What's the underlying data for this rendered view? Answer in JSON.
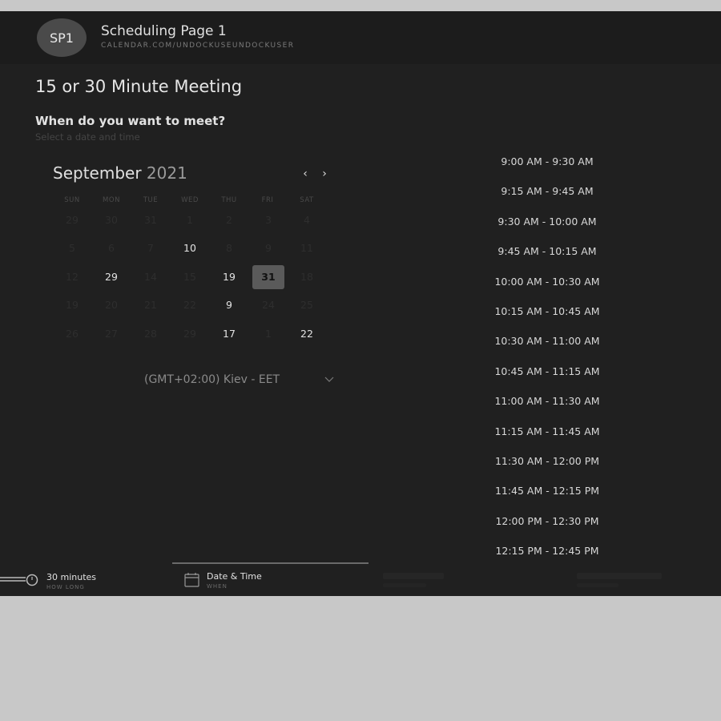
{
  "header": {
    "avatar_initials": "SP1",
    "title": "Scheduling Page 1",
    "url": "CALENDAR.COM/UNDOCKUSEUNDOCKUSER"
  },
  "meeting": {
    "title": "15 or 30 Minute Meeting",
    "question": "When do you want to meet?",
    "hint": "Select a date and time"
  },
  "calendar": {
    "month": "September",
    "year": "2021",
    "prev_label": "‹",
    "next_label": "›",
    "weekdays": [
      "SUN",
      "MON",
      "TUE",
      "WED",
      "THU",
      "FRI",
      "SAT"
    ],
    "weeks": [
      [
        {
          "d": "29",
          "a": false
        },
        {
          "d": "30",
          "a": false
        },
        {
          "d": "31",
          "a": false
        },
        {
          "d": "1",
          "a": false
        },
        {
          "d": "2",
          "a": false
        },
        {
          "d": "3",
          "a": false
        },
        {
          "d": "4",
          "a": false
        }
      ],
      [
        {
          "d": "5",
          "a": false
        },
        {
          "d": "6",
          "a": false
        },
        {
          "d": "7",
          "a": false
        },
        {
          "d": "10",
          "a": true
        },
        {
          "d": "8",
          "a": false
        },
        {
          "d": "9",
          "a": false
        },
        {
          "d": "11",
          "a": false
        }
      ],
      [
        {
          "d": "12",
          "a": false
        },
        {
          "d": "29",
          "a": true
        },
        {
          "d": "14",
          "a": false
        },
        {
          "d": "15",
          "a": false
        },
        {
          "d": "19",
          "a": true
        },
        {
          "d": "31",
          "a": true,
          "sel": true
        },
        {
          "d": "18",
          "a": false
        }
      ],
      [
        {
          "d": "19",
          "a": false
        },
        {
          "d": "20",
          "a": false
        },
        {
          "d": "21",
          "a": false
        },
        {
          "d": "22",
          "a": false
        },
        {
          "d": "9",
          "a": true
        },
        {
          "d": "24",
          "a": false
        },
        {
          "d": "25",
          "a": false
        }
      ],
      [
        {
          "d": "26",
          "a": false
        },
        {
          "d": "27",
          "a": false
        },
        {
          "d": "28",
          "a": false
        },
        {
          "d": "29",
          "a": false
        },
        {
          "d": "17",
          "a": true
        },
        {
          "d": "1",
          "a": false
        },
        {
          "d": "22",
          "a": true
        }
      ]
    ],
    "timezone": "(GMT+02:00) Kiev - EET"
  },
  "slots": [
    "9:00 AM - 9:30 AM",
    "9:15 AM - 9:45 AM",
    "9:30 AM - 10:00 AM",
    "9:45 AM - 10:15 AM",
    "10:00 AM - 10:30 AM",
    "10:15 AM - 10:45 AM",
    "10:30 AM - 11:00 AM",
    "10:45 AM - 11:15 AM",
    "11:00 AM - 11:30 AM",
    "11:15 AM - 11:45 AM",
    "11:30 AM - 12:00 PM",
    "11:45 AM - 12:15 PM",
    "12:00 PM - 12:30 PM",
    "12:15 PM - 12:45 PM"
  ],
  "footer": {
    "duration_label": "30 minutes",
    "duration_sub": "HOW LONG",
    "datetime_label": "Date & Time",
    "datetime_sub": "WHEN"
  },
  "icons": {
    "duration": "stopwatch-icon",
    "datetime": "calendar-icon",
    "prev": "chevron-left-icon",
    "next": "chevron-right-icon",
    "timezone": "chevron-down-icon"
  }
}
